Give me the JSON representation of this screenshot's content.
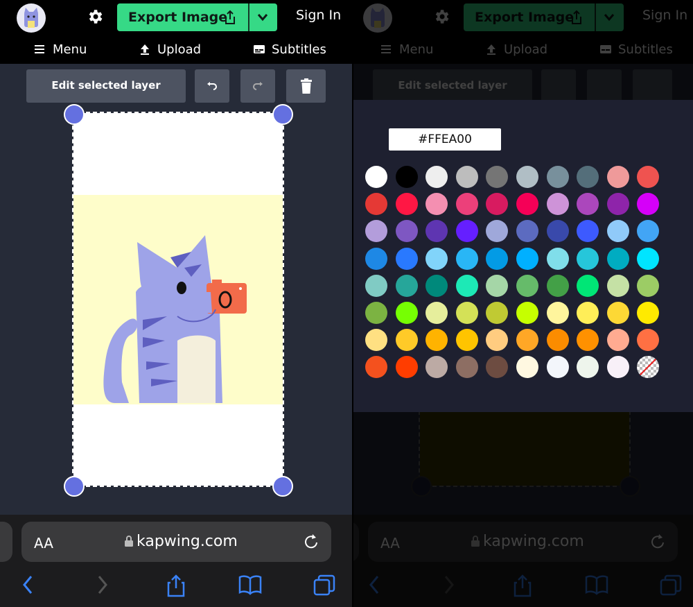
{
  "header": {
    "export_label": "Export Image",
    "signin_label": "Sign In",
    "menu_items": [
      "Menu",
      "Upload",
      "Subtitles"
    ]
  },
  "toolbar": {
    "edit_layer_label": "Edit selected layer"
  },
  "color_picker": {
    "hex_value": "#FFEA00",
    "swatches": [
      [
        "#FFFFFF",
        "#000000",
        "#EEEEEE",
        "#BDBDBD",
        "#757575",
        "#B0BEC5",
        "#78909C",
        "#546E7A",
        "#EF9A9A",
        "#EF5350"
      ],
      [
        "#E53935",
        "#FF1744",
        "#F48FB1",
        "#EC407A",
        "#D81B60",
        "#F50057",
        "#CE93D8",
        "#AB47BC",
        "#8E24AA",
        "#D500F9"
      ],
      [
        "#B39DDB",
        "#7E57C2",
        "#5E35B1",
        "#651FFF",
        "#9FA8DA",
        "#5C6BC0",
        "#3949AB",
        "#3D5AFE",
        "#90CAF9",
        "#42A5F5"
      ],
      [
        "#1E88E5",
        "#2979FF",
        "#81D4FA",
        "#29B6F6",
        "#039BE5",
        "#00B0FF",
        "#80DEEA",
        "#26C6DA",
        "#00ACC1",
        "#00E5FF"
      ],
      [
        "#80CBC4",
        "#26A69A",
        "#00897B",
        "#1DE9B6",
        "#A5D6A7",
        "#66BB6A",
        "#43A047",
        "#00E676",
        "#C5E1A5",
        "#9CCC65"
      ],
      [
        "#7CB342",
        "#76FF03",
        "#E6EE9C",
        "#D4E157",
        "#C0CA33",
        "#C6FF00",
        "#FFF59D",
        "#FFEE58",
        "#FDD835",
        "#FFEA00"
      ],
      [
        "#FFE082",
        "#FFCA28",
        "#FFB300",
        "#FFC400",
        "#FFCC80",
        "#FFA726",
        "#FB8C00",
        "#FF9100",
        "#FFAB91",
        "#FF7043"
      ],
      [
        "#F4511E",
        "#FF3D00",
        "#BCAAA4",
        "#8D6E63",
        "#6D4C41",
        "#FFF8E1",
        "#F3F6FB",
        "#EEF5EC",
        "#F8F0F8",
        "transparent"
      ]
    ]
  },
  "browser": {
    "aa_label": "AA",
    "domain": "kapwing.com"
  },
  "colors": {
    "accent_green": "#36D986",
    "handle_blue": "#6470E0",
    "app_bg": "#262B38",
    "canvas_yellow": "#FEFDCA"
  },
  "icons": [
    "gear-icon",
    "share-icon",
    "chevron-down-icon",
    "hamburger-icon",
    "upload-icon",
    "subtitles-icon",
    "undo-icon",
    "redo-icon",
    "trash-icon",
    "lock-icon",
    "reload-icon",
    "back-icon",
    "forward-icon",
    "share-icon",
    "bookmarks-icon",
    "tabs-icon"
  ]
}
